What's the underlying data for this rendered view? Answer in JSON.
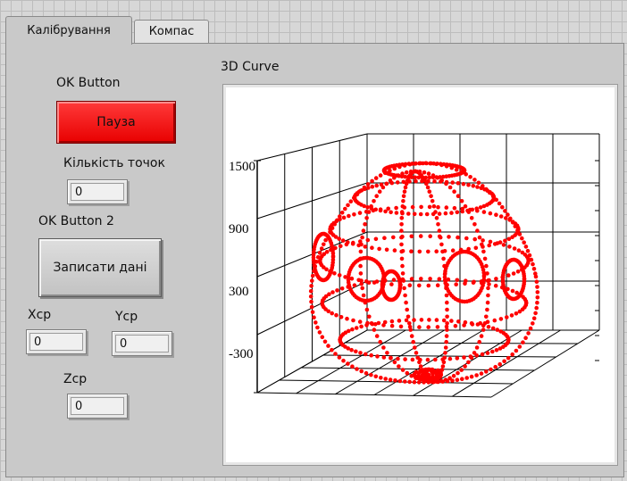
{
  "tabs": [
    {
      "label": "Калібрування",
      "active": true
    },
    {
      "label": "Компас",
      "active": false
    }
  ],
  "ok_button": {
    "caption": "OK Button",
    "label": "Пауза",
    "color": "#ff1a1a"
  },
  "points_count": {
    "caption": "Кількість точок",
    "value": "0"
  },
  "ok_button_2": {
    "caption": "OK Button 2",
    "label": "Записати дані"
  },
  "xcp": {
    "caption": "Xcp",
    "value": "0"
  },
  "ycp": {
    "caption": "Ycp",
    "value": "0"
  },
  "zcp": {
    "caption": "Zcp",
    "value": "0"
  },
  "plot": {
    "caption": "3D Curve",
    "z_tick_labels": [
      "1500",
      "900",
      "300",
      "-300"
    ],
    "point_color": "#ff0000"
  }
}
